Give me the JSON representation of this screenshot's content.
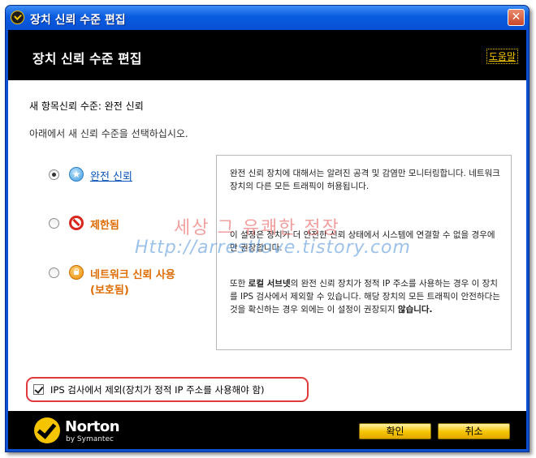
{
  "window": {
    "title": "장치 신뢰 수준 편집",
    "close_glyph": "✕"
  },
  "header": {
    "title": "장치 신뢰 수준 편집",
    "help_label": "도움말"
  },
  "content": {
    "level_line": "새 항목신뢰 수준: 완전 신뢰",
    "instruction": "아래에서 새 신뢰 수준을 선택하십시오.",
    "options": [
      {
        "label": "완전 신뢰",
        "icon": "star-icon",
        "selected": true
      },
      {
        "label": "제한됨",
        "icon": "block-icon",
        "selected": false
      },
      {
        "label": "네트워크 신뢰 사용",
        "label_line2": "(보호됨)",
        "icon": "lock-icon",
        "selected": false
      }
    ],
    "description": {
      "p1": "완전 신뢰 장치에 대해서는 알려진 공격 및 감염만 모니터링합니다. 네트워크 장치의 다른 모든 트래픽이 허용됩니다.",
      "p2": "이 설정은 장치가 더 안전한 신뢰 상태에서 시스템에 연결할 수 없을 경우에만 권장합니다.",
      "p3_pre": "또한 ",
      "p3_bold": "로컬 서브넷",
      "p3_mid": "의 완전 신뢰 장치가 정적 IP 주소를 사용하는 경우 이 장치를 IPS 검사에서 제외할 수 있습니다. 해당 장치의 모든 트래픽이 안전하다는 것을 확신하는 경우 외에는 이 설정이 권장되지 ",
      "p3_bold2": "않습니다."
    },
    "ips_checkbox": {
      "label": "IPS 검사에서 제외(장치가 정적 IP 주소를 사용해야 함)",
      "checked": true
    },
    "watermark": {
      "line1": "세상 그 유쾌한 정장",
      "line2": "Http://arrestlove.tistory.com"
    }
  },
  "footer": {
    "brand": "Norton",
    "brand_sub": "by Symantec",
    "ok_label": "확인",
    "cancel_label": "취소"
  },
  "colors": {
    "titlebar": "#0a5ce0",
    "accent_yellow": "#f5c400",
    "link_blue": "#0b54b8",
    "warning_orange": "#de6b00",
    "highlight_red": "#e03a3a"
  }
}
